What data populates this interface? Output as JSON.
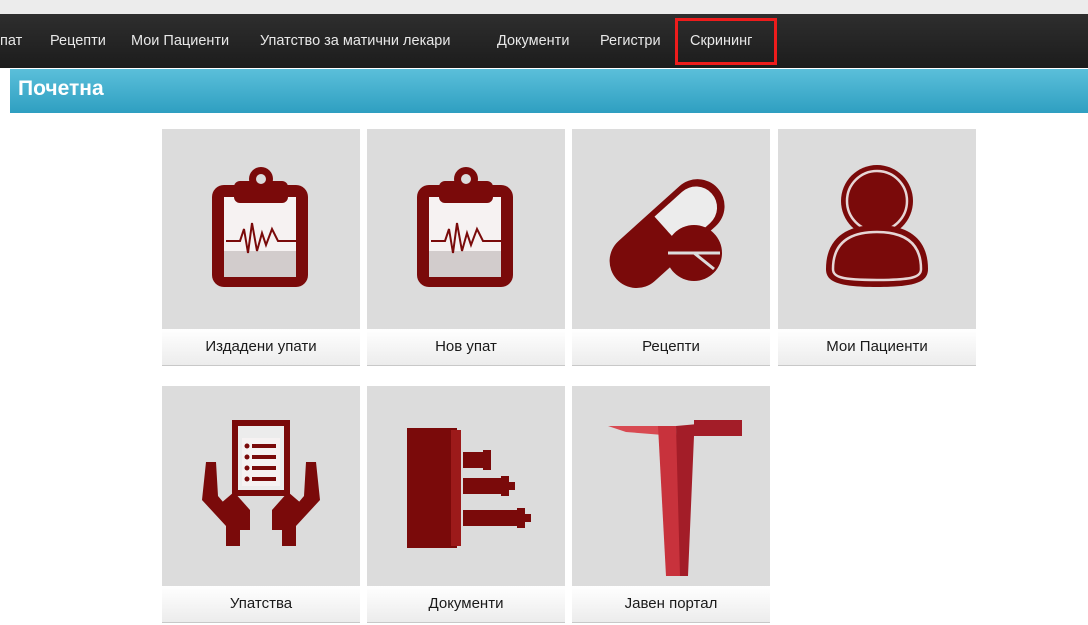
{
  "nav": {
    "items": [
      {
        "label": "пат"
      },
      {
        "label": "Рецепти"
      },
      {
        "label": "Мои Пациенти"
      },
      {
        "label": "Упатство за матични лекари"
      },
      {
        "label": "Документи"
      },
      {
        "label": "Регистри"
      },
      {
        "label": "Скрининг",
        "highlighted": true
      }
    ]
  },
  "page": {
    "title": "Почетна"
  },
  "tiles": [
    {
      "label": "Издадени упати",
      "icon": "clipboard-ecg-icon"
    },
    {
      "label": "Нов упат",
      "icon": "clipboard-ecg-icon"
    },
    {
      "label": "Рецепти",
      "icon": "pill-icon"
    },
    {
      "label": "Мои Пациенти",
      "icon": "user-icon"
    },
    {
      "label": "Упатства",
      "icon": "hands-document-icon"
    },
    {
      "label": "Документи",
      "icon": "documents-chart-icon"
    },
    {
      "label": "Јавен портал",
      "icon": "portal-logo-icon"
    }
  ],
  "colors": {
    "navbar": "#222222",
    "page_bar": "#3aa9cc",
    "icon": "#7a0a0a",
    "tile_bg": "#dcdcdc",
    "highlight": "#ee1c1c"
  }
}
